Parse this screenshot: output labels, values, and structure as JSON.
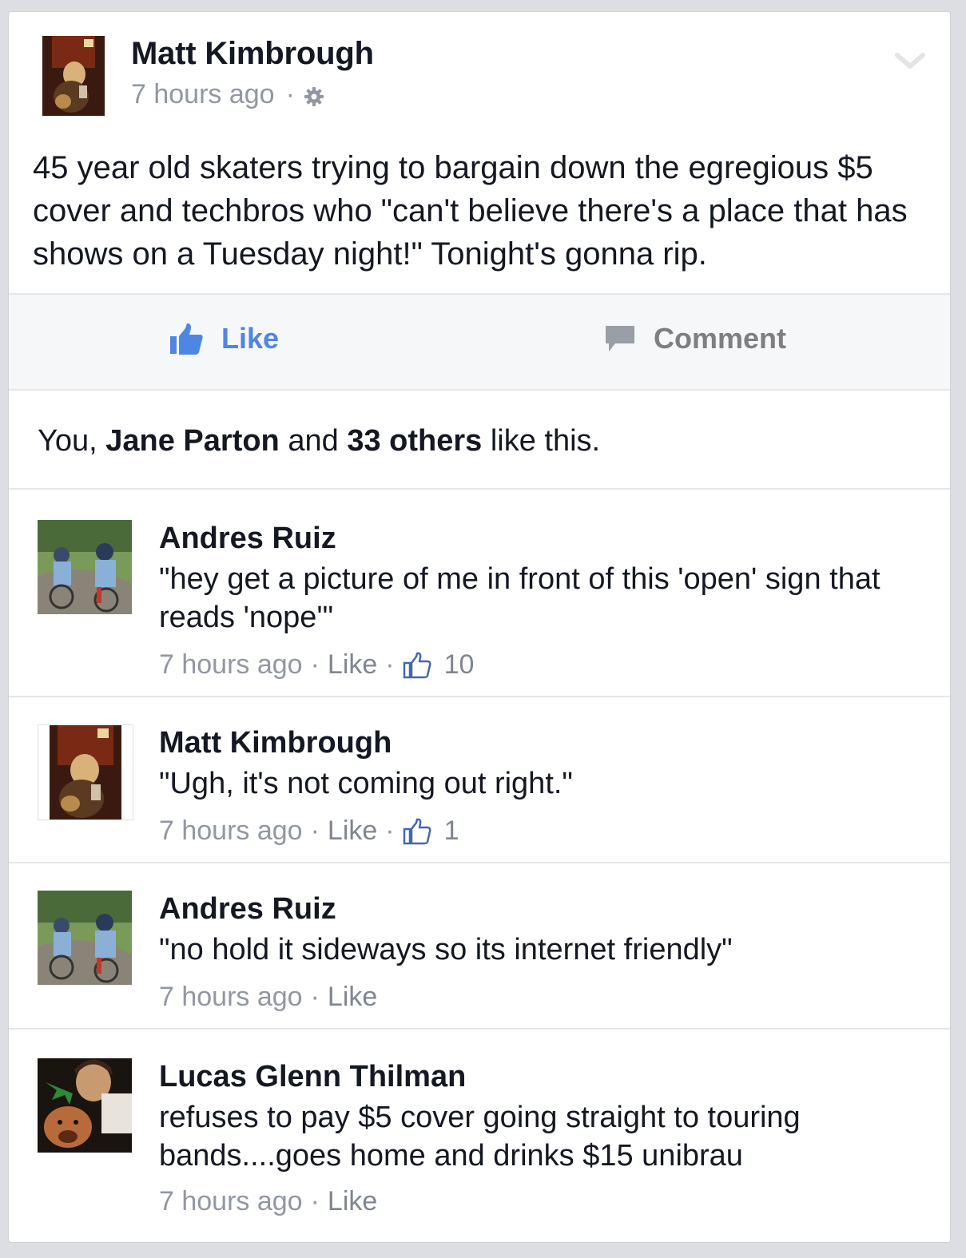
{
  "post": {
    "author": "Matt Kimbrough",
    "timestamp": "7 hours ago",
    "dot": "·",
    "body": "45 year old skaters trying to bargain down the egregious $5 cover and techbros who \"can't believe there's a place that has shows on a Tuesday night!\" Tonight's gonna rip."
  },
  "actions": {
    "like_label": "Like",
    "comment_label": "Comment"
  },
  "likes": {
    "prefix": "You, ",
    "name": "Jane Parton",
    "middle": " and ",
    "others": "33 others",
    "suffix": " like this."
  },
  "comments": [
    {
      "author": "Andres Ruiz",
      "text": "\"hey get a picture of me in front of this 'open' sign that reads 'nope'\"",
      "timestamp": "7 hours ago",
      "like_label": "Like",
      "like_count": "10"
    },
    {
      "author": "Matt Kimbrough",
      "text": "\"Ugh, it's not coming out right.\"",
      "timestamp": "7 hours ago",
      "like_label": "Like",
      "like_count": "1"
    },
    {
      "author": "Andres Ruiz",
      "text": "\"no hold it sideways so its internet friendly\"",
      "timestamp": "7 hours ago",
      "like_label": "Like"
    },
    {
      "author": "Lucas Glenn Thilman",
      "text": "refuses to pay $5 cover going straight to touring bands....goes home and drinks $15 unibrau",
      "timestamp": "7 hours ago",
      "like_label": "Like"
    }
  ],
  "icons": {
    "gear": "gear-icon",
    "chevron": "chevron-down-icon",
    "like": "thumbs-up-icon",
    "comment": "speech-bubble-icon"
  },
  "colors": {
    "link_blue": "#4e86e4",
    "meta_gray": "#9197a3",
    "action_bar_bg": "#f6f7f9",
    "thumb_blue": "#4267b2"
  }
}
